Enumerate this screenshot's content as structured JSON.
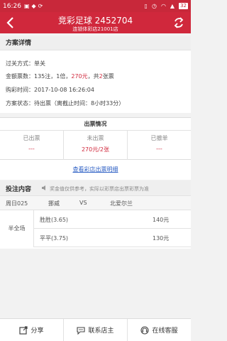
{
  "statusbar": {
    "time": "16:26",
    "battery": "32"
  },
  "header": {
    "title": "竞彩足球  2452704",
    "subtitle": "连锁体彩店21001店"
  },
  "detail": {
    "section_title": "方案详情",
    "pass_type": "过关方式：单关",
    "amount_prefix": "金额票数：135注，1倍，",
    "amount_value": "270元",
    "amount_mid": "，共",
    "amount_tickets": "2",
    "amount_suffix": "张票",
    "buy_time": "购彩时间：2017-10-08 16:26:04",
    "status": "方案状态：待出票（离截止时间：8小时33分）"
  },
  "ticketing": {
    "title": "出票情况",
    "cols": [
      {
        "label": "已出票",
        "value": "---"
      },
      {
        "label": "未出票",
        "value": "270元/2张"
      },
      {
        "label": "已撤单",
        "value": "---"
      }
    ],
    "detail_link": "查看彩店出票明细"
  },
  "bet": {
    "title": "投注内容",
    "note": "奖金值仅供参考，实际以彩票店出票彩票为准",
    "match": {
      "id": "周日025",
      "home": "挪威",
      "vs": "VS",
      "away": "北爱尔兰"
    },
    "play": "半全场",
    "lines": [
      {
        "option": "胜胜(3.65)",
        "amount": "140元"
      },
      {
        "option": "平平(3.75)",
        "amount": "130元"
      }
    ]
  },
  "bottombar": {
    "share": "分享",
    "contact": "联系店主",
    "service": "在线客服"
  }
}
